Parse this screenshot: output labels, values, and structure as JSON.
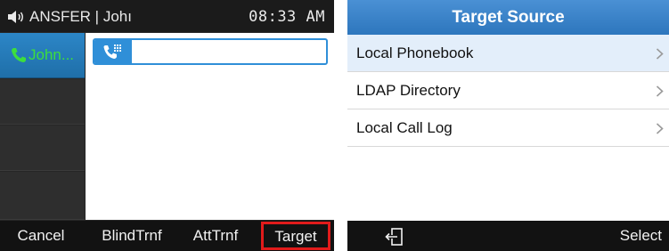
{
  "left_screen": {
    "status": {
      "speaker_icon": "speaker-volume-icon",
      "account": "ANSFER | Johı",
      "time": "08:33 AM"
    },
    "line_keys": [
      {
        "label": "John...",
        "active": true,
        "icon": "handset-icon"
      },
      {
        "label": ""
      },
      {
        "label": ""
      },
      {
        "label": ""
      }
    ],
    "dial_input": {
      "icon": "dialpad-handset-icon",
      "value": ""
    },
    "softkeys": [
      {
        "label": "Cancel"
      },
      {
        "label": "BlindTrnf"
      },
      {
        "label": "AttTrnf"
      },
      {
        "label": "Target",
        "highlighted": true
      }
    ],
    "colors": {
      "accent_blue": "#2f8fd8",
      "active_text_green": "#3dde3d",
      "highlight_red": "#e11b1b"
    }
  },
  "right_screen": {
    "title": "Target Source",
    "items": [
      {
        "label": "Local Phonebook",
        "selected": true
      },
      {
        "label": "LDAP Directory"
      },
      {
        "label": "Local Call Log"
      }
    ],
    "softkeys": {
      "back_icon": "back-exit-icon",
      "select": "Select"
    },
    "colors": {
      "header_blue": "#3a84c9",
      "selected_row": "#e3eefa"
    }
  }
}
